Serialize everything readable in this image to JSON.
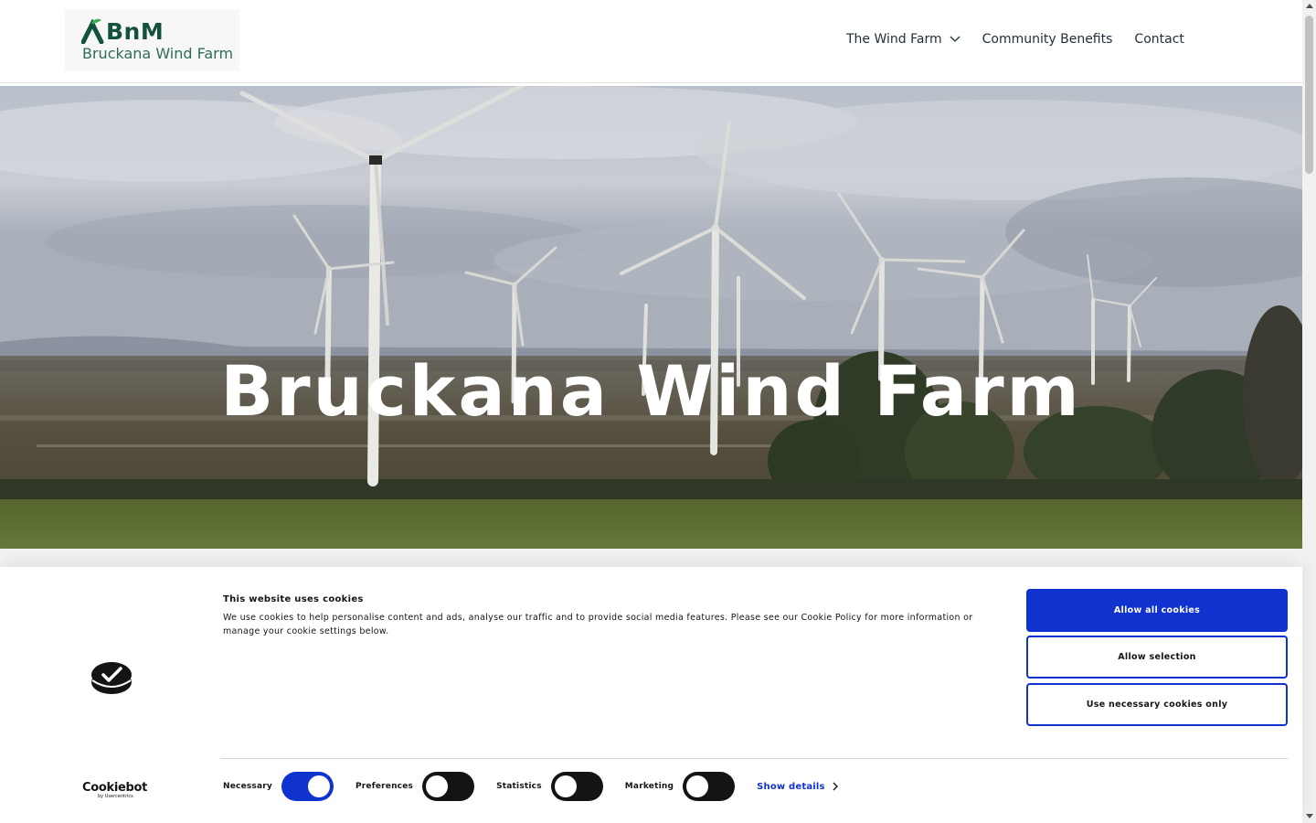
{
  "header": {
    "logo": {
      "brand": "BnM",
      "name": "Bruckana Wind Farm"
    },
    "nav": [
      {
        "label": "The Wind Farm",
        "has_dropdown": true
      },
      {
        "label": "Community Benefits",
        "has_dropdown": false
      },
      {
        "label": "Contact",
        "has_dropdown": false
      }
    ]
  },
  "hero": {
    "title": "Bruckana Wind Farm",
    "image": "wind-turbines-landscape"
  },
  "cookie_banner": {
    "title": "This website uses cookies",
    "text": "We use cookies to help personalise content and ads, analyse our traffic and to provide social media features. Please see our Cookie Policy for more information or manage your cookie settings below.",
    "brand": "Cookiebot",
    "brand_sub": "by Usercentrics",
    "buttons": {
      "allow_all": "Allow all cookies",
      "allow_selection": "Allow selection",
      "necessary_only": "Use necessary cookies only"
    },
    "toggles": [
      {
        "label": "Necessary",
        "checked": true
      },
      {
        "label": "Preferences",
        "checked": false
      },
      {
        "label": "Statistics",
        "checked": false
      },
      {
        "label": "Marketing",
        "checked": false
      }
    ],
    "show_details": "Show details"
  },
  "colors": {
    "accent": "#1032cf",
    "brand_green": "#14523b",
    "logo_leaf": "#3fae5a"
  }
}
